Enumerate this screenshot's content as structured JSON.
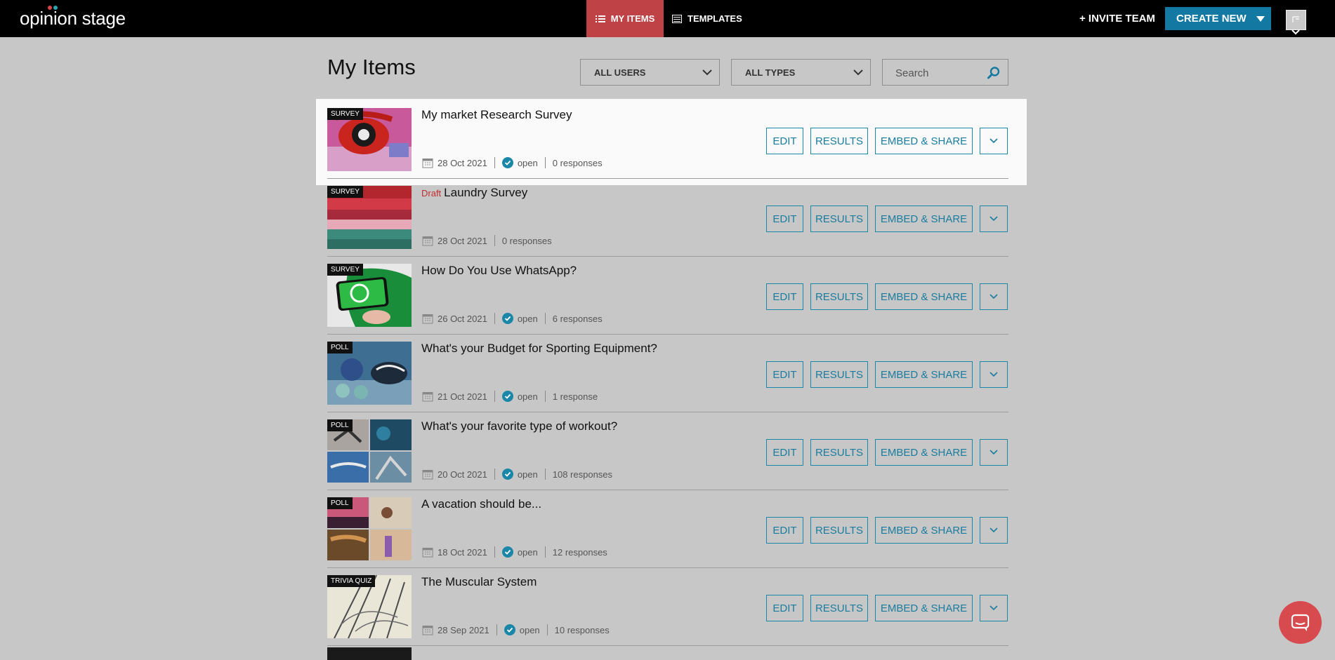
{
  "topbar": {
    "logo": "opinion stage",
    "tabs": [
      {
        "label": "MY ITEMS",
        "icon": "list-icon",
        "active": true
      },
      {
        "label": "TEMPLATES",
        "icon": "templates-icon",
        "active": false
      }
    ],
    "invite_label": "+ INVITE TEAM",
    "create_label": "CREATE NEW"
  },
  "header": {
    "title": "My Items",
    "users_filter": "ALL USERS",
    "types_filter": "ALL TYPES",
    "search_placeholder": "Search"
  },
  "buttons": {
    "edit": "EDIT",
    "results": "RESULTS",
    "embed": "EMBED & SHARE"
  },
  "items": [
    {
      "type": "SURVEY",
      "draft": "",
      "title": "My market Research Survey",
      "date": "28 Oct 2021",
      "status": "open",
      "responses": "0 responses"
    },
    {
      "type": "SURVEY",
      "draft": "Draft",
      "title": "Laundry Survey",
      "date": "28 Oct 2021",
      "status": "",
      "responses": "0 responses"
    },
    {
      "type": "SURVEY",
      "draft": "",
      "title": "How Do You Use WhatsApp?",
      "date": "26 Oct 2021",
      "status": "open",
      "responses": "6 responses"
    },
    {
      "type": "POLL",
      "draft": "",
      "title": "What's your Budget for Sporting Equipment?",
      "date": "21 Oct 2021",
      "status": "open",
      "responses": "1 response"
    },
    {
      "type": "POLL",
      "draft": "",
      "title": "What's your favorite type of workout?",
      "date": "20 Oct 2021",
      "status": "open",
      "responses": "108 responses"
    },
    {
      "type": "POLL",
      "draft": "",
      "title": "A vacation should be...",
      "date": "18 Oct 2021",
      "status": "open",
      "responses": "12 responses"
    },
    {
      "type": "TRIVIA QUIZ",
      "draft": "",
      "title": "The Muscular System",
      "date": "28 Sep 2021",
      "status": "open",
      "responses": "10 responses"
    }
  ],
  "colors": {
    "accent": "#1479a2",
    "active_tab": "#bf4246",
    "draft": "#c12d2d",
    "chat": "#d74a4e"
  }
}
